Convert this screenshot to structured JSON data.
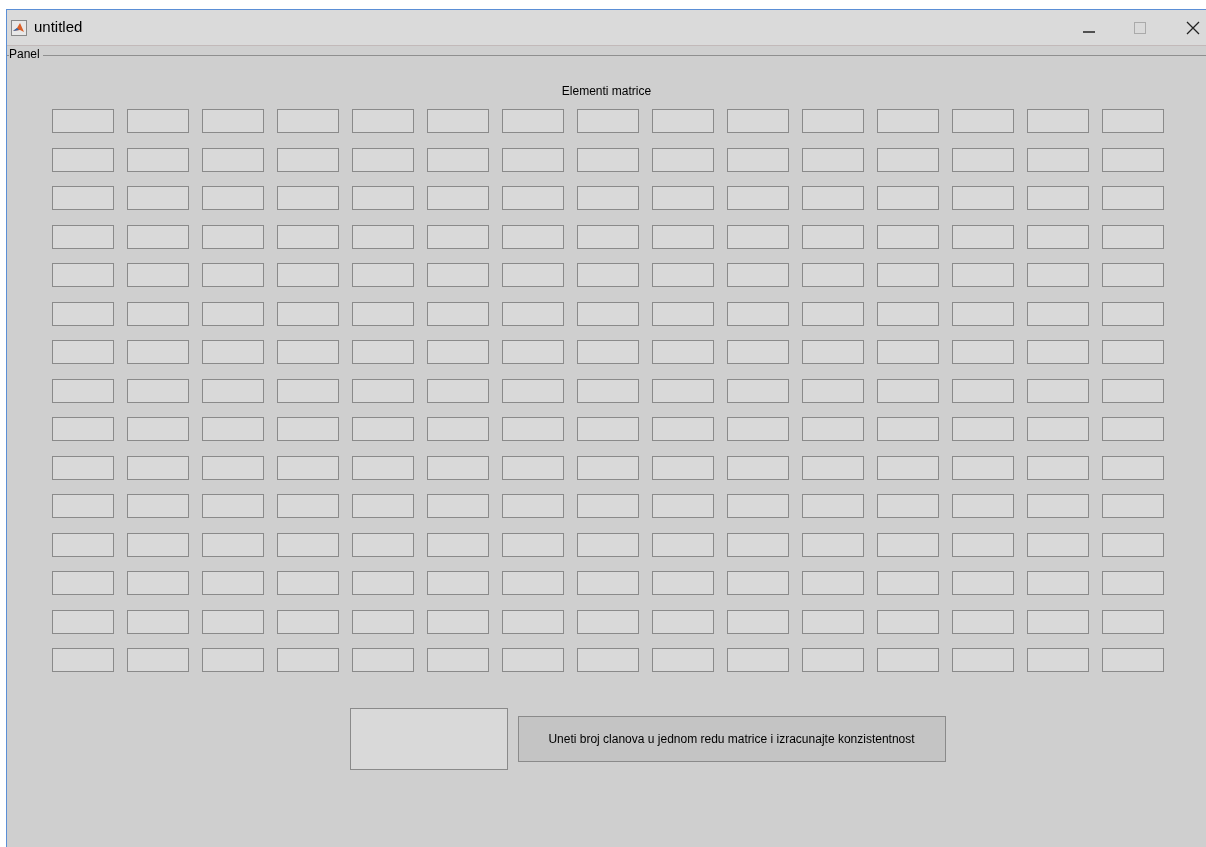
{
  "window": {
    "title": "untitled"
  },
  "panel": {
    "title": "Panel",
    "heading": "Elementi matrice",
    "matrix": [
      [
        {
          "kind": "field"
        },
        {
          "kind": "field"
        },
        {
          "kind": "field"
        },
        {
          "kind": "field"
        },
        {
          "kind": "field"
        },
        {
          "kind": "field"
        },
        {
          "kind": "field"
        },
        {
          "kind": "field"
        },
        {
          "kind": "field"
        },
        {
          "kind": "field"
        },
        {
          "kind": "field"
        },
        {
          "kind": "field"
        },
        {
          "kind": "field"
        },
        {
          "kind": "field"
        },
        {
          "kind": "field"
        }
      ],
      [
        {
          "kind": "field"
        },
        {
          "kind": "field"
        },
        {
          "kind": "field"
        },
        {
          "kind": "field"
        },
        {
          "kind": "field"
        },
        {
          "kind": "field"
        },
        {
          "kind": "field"
        },
        {
          "kind": "field"
        },
        {
          "kind": "field"
        },
        {
          "kind": "field"
        },
        {
          "kind": "field"
        },
        {
          "kind": "field"
        },
        {
          "kind": "field"
        },
        {
          "kind": "field"
        },
        {
          "kind": "field"
        }
      ],
      [
        {
          "kind": "field"
        },
        {
          "kind": "field"
        },
        {
          "kind": "field"
        },
        {
          "kind": "field"
        },
        {
          "kind": "field"
        },
        {
          "kind": "field"
        },
        {
          "kind": "field"
        },
        {
          "kind": "field"
        },
        {
          "kind": "field"
        },
        {
          "kind": "field"
        },
        {
          "kind": "field"
        },
        {
          "kind": "field"
        },
        {
          "kind": "field"
        },
        {
          "kind": "field"
        },
        {
          "kind": "field"
        }
      ],
      [
        {
          "kind": "field"
        },
        {
          "kind": "field"
        },
        {
          "kind": "field"
        },
        {
          "kind": "field"
        },
        {
          "kind": "field"
        },
        {
          "kind": "field"
        },
        {
          "kind": "field"
        },
        {
          "kind": "field"
        },
        {
          "kind": "field"
        },
        {
          "kind": "field"
        },
        {
          "kind": "field"
        },
        {
          "kind": "field"
        },
        {
          "kind": "field"
        },
        {
          "kind": "field"
        },
        {
          "kind": "field"
        }
      ],
      [
        {
          "kind": "field"
        },
        {
          "kind": "field"
        },
        {
          "kind": "field"
        },
        {
          "kind": "field"
        },
        {
          "kind": "field"
        },
        {
          "kind": "field"
        },
        {
          "kind": "field"
        },
        {
          "kind": "field"
        },
        {
          "kind": "field"
        },
        {
          "kind": "field"
        },
        {
          "kind": "field"
        },
        {
          "kind": "field"
        },
        {
          "kind": "field"
        },
        {
          "kind": "field"
        },
        {
          "kind": "field"
        }
      ],
      [
        {
          "kind": "field"
        },
        {
          "kind": "field"
        },
        {
          "kind": "field"
        },
        {
          "kind": "field"
        },
        {
          "kind": "field"
        },
        {
          "kind": "field"
        },
        {
          "kind": "field"
        },
        {
          "kind": "field"
        },
        {
          "kind": "field"
        },
        {
          "kind": "field"
        },
        {
          "kind": "field"
        },
        {
          "kind": "field"
        },
        {
          "kind": "field"
        },
        {
          "kind": "field"
        },
        {
          "kind": "field"
        }
      ],
      [
        {
          "kind": "field"
        },
        {
          "kind": "field"
        },
        {
          "kind": "field"
        },
        {
          "kind": "field"
        },
        {
          "kind": "field"
        },
        {
          "kind": "field"
        },
        {
          "kind": "field"
        },
        {
          "kind": "field"
        },
        {
          "kind": "field"
        },
        {
          "kind": "field"
        },
        {
          "kind": "field"
        },
        {
          "kind": "field"
        },
        {
          "kind": "field"
        },
        {
          "kind": "field"
        },
        {
          "kind": "field"
        }
      ],
      [
        {
          "kind": "field"
        },
        {
          "kind": "field"
        },
        {
          "kind": "field"
        },
        {
          "kind": "field"
        },
        {
          "kind": "field"
        },
        {
          "kind": "field"
        },
        {
          "kind": "field"
        },
        {
          "kind": "field"
        },
        {
          "kind": "field"
        },
        {
          "kind": "field"
        },
        {
          "kind": "field"
        },
        {
          "kind": "field"
        },
        {
          "kind": "field"
        },
        {
          "kind": "field"
        },
        {
          "kind": "field"
        }
      ],
      [
        {
          "kind": "field"
        },
        {
          "kind": "field"
        },
        {
          "kind": "field"
        },
        {
          "kind": "field"
        },
        {
          "kind": "field"
        },
        {
          "kind": "field"
        },
        {
          "kind": "field"
        },
        {
          "kind": "field"
        },
        {
          "kind": "field"
        },
        {
          "kind": "field"
        },
        {
          "kind": "field"
        },
        {
          "kind": "field"
        },
        {
          "kind": "field"
        },
        {
          "kind": "field"
        },
        {
          "kind": "field"
        }
      ],
      [
        {
          "kind": "field"
        },
        {
          "kind": "field"
        },
        {
          "kind": "field"
        },
        {
          "kind": "field"
        },
        {
          "kind": "field"
        },
        {
          "kind": "field"
        },
        {
          "kind": "field"
        },
        {
          "kind": "field"
        },
        {
          "kind": "field"
        },
        {
          "kind": "field"
        },
        {
          "kind": "field"
        },
        {
          "kind": "field"
        },
        {
          "kind": "field"
        },
        {
          "kind": "field"
        },
        {
          "kind": "field"
        }
      ],
      [
        {
          "kind": "field"
        },
        {
          "kind": "field"
        },
        {
          "kind": "field"
        },
        {
          "kind": "field"
        },
        {
          "kind": "field"
        },
        {
          "kind": "field"
        },
        {
          "kind": "field"
        },
        {
          "kind": "field"
        },
        {
          "kind": "field"
        },
        {
          "kind": "field"
        },
        {
          "kind": "field"
        },
        {
          "kind": "field"
        },
        {
          "kind": "field"
        },
        {
          "kind": "field"
        },
        {
          "kind": "field"
        }
      ],
      [
        {
          "kind": "field"
        },
        {
          "kind": "field"
        },
        {
          "kind": "field"
        },
        {
          "kind": "field"
        },
        {
          "kind": "field"
        },
        {
          "kind": "field"
        },
        {
          "kind": "field"
        },
        {
          "kind": "field"
        },
        {
          "kind": "field"
        },
        {
          "kind": "field"
        },
        {
          "kind": "field"
        },
        {
          "kind": "field"
        },
        {
          "kind": "field"
        },
        {
          "kind": "field"
        },
        {
          "kind": "field"
        }
      ],
      [
        {
          "kind": "field"
        },
        {
          "kind": "field"
        },
        {
          "kind": "field"
        },
        {
          "kind": "field"
        },
        {
          "kind": "field"
        },
        {
          "kind": "field"
        },
        {
          "kind": "field"
        },
        {
          "kind": "field"
        },
        {
          "kind": "field"
        },
        {
          "kind": "field"
        },
        {
          "kind": "field"
        },
        {
          "kind": "field"
        },
        {
          "kind": "field"
        },
        {
          "kind": "field"
        },
        {
          "kind": "field"
        }
      ],
      [
        {
          "kind": "field"
        },
        {
          "kind": "field"
        },
        {
          "kind": "field"
        },
        {
          "kind": "field"
        },
        {
          "kind": "field"
        },
        {
          "kind": "field"
        },
        {
          "kind": "field"
        },
        {
          "kind": "field"
        },
        {
          "kind": "field"
        },
        {
          "kind": "field"
        },
        {
          "kind": "field"
        },
        {
          "kind": "field"
        },
        {
          "kind": "field"
        },
        {
          "kind": "field"
        },
        {
          "kind": "field"
        }
      ],
      [
        {
          "kind": "field"
        },
        {
          "kind": "field"
        },
        {
          "kind": "field"
        },
        {
          "kind": "field"
        },
        {
          "kind": "field"
        },
        {
          "kind": "field"
        },
        {
          "kind": "field"
        },
        {
          "kind": "field"
        },
        {
          "kind": "field"
        },
        {
          "kind": "field"
        },
        {
          "kind": "field"
        },
        {
          "kind": "field"
        },
        {
          "kind": "field"
        },
        {
          "kind": "field"
        },
        {
          "kind": "field"
        }
      ]
    ],
    "size_field": {
      "kind": "field"
    },
    "compute_button": {
      "label": "Uneti broj clanova u jednom redu matrice i izracunajte konzistentnost"
    }
  }
}
